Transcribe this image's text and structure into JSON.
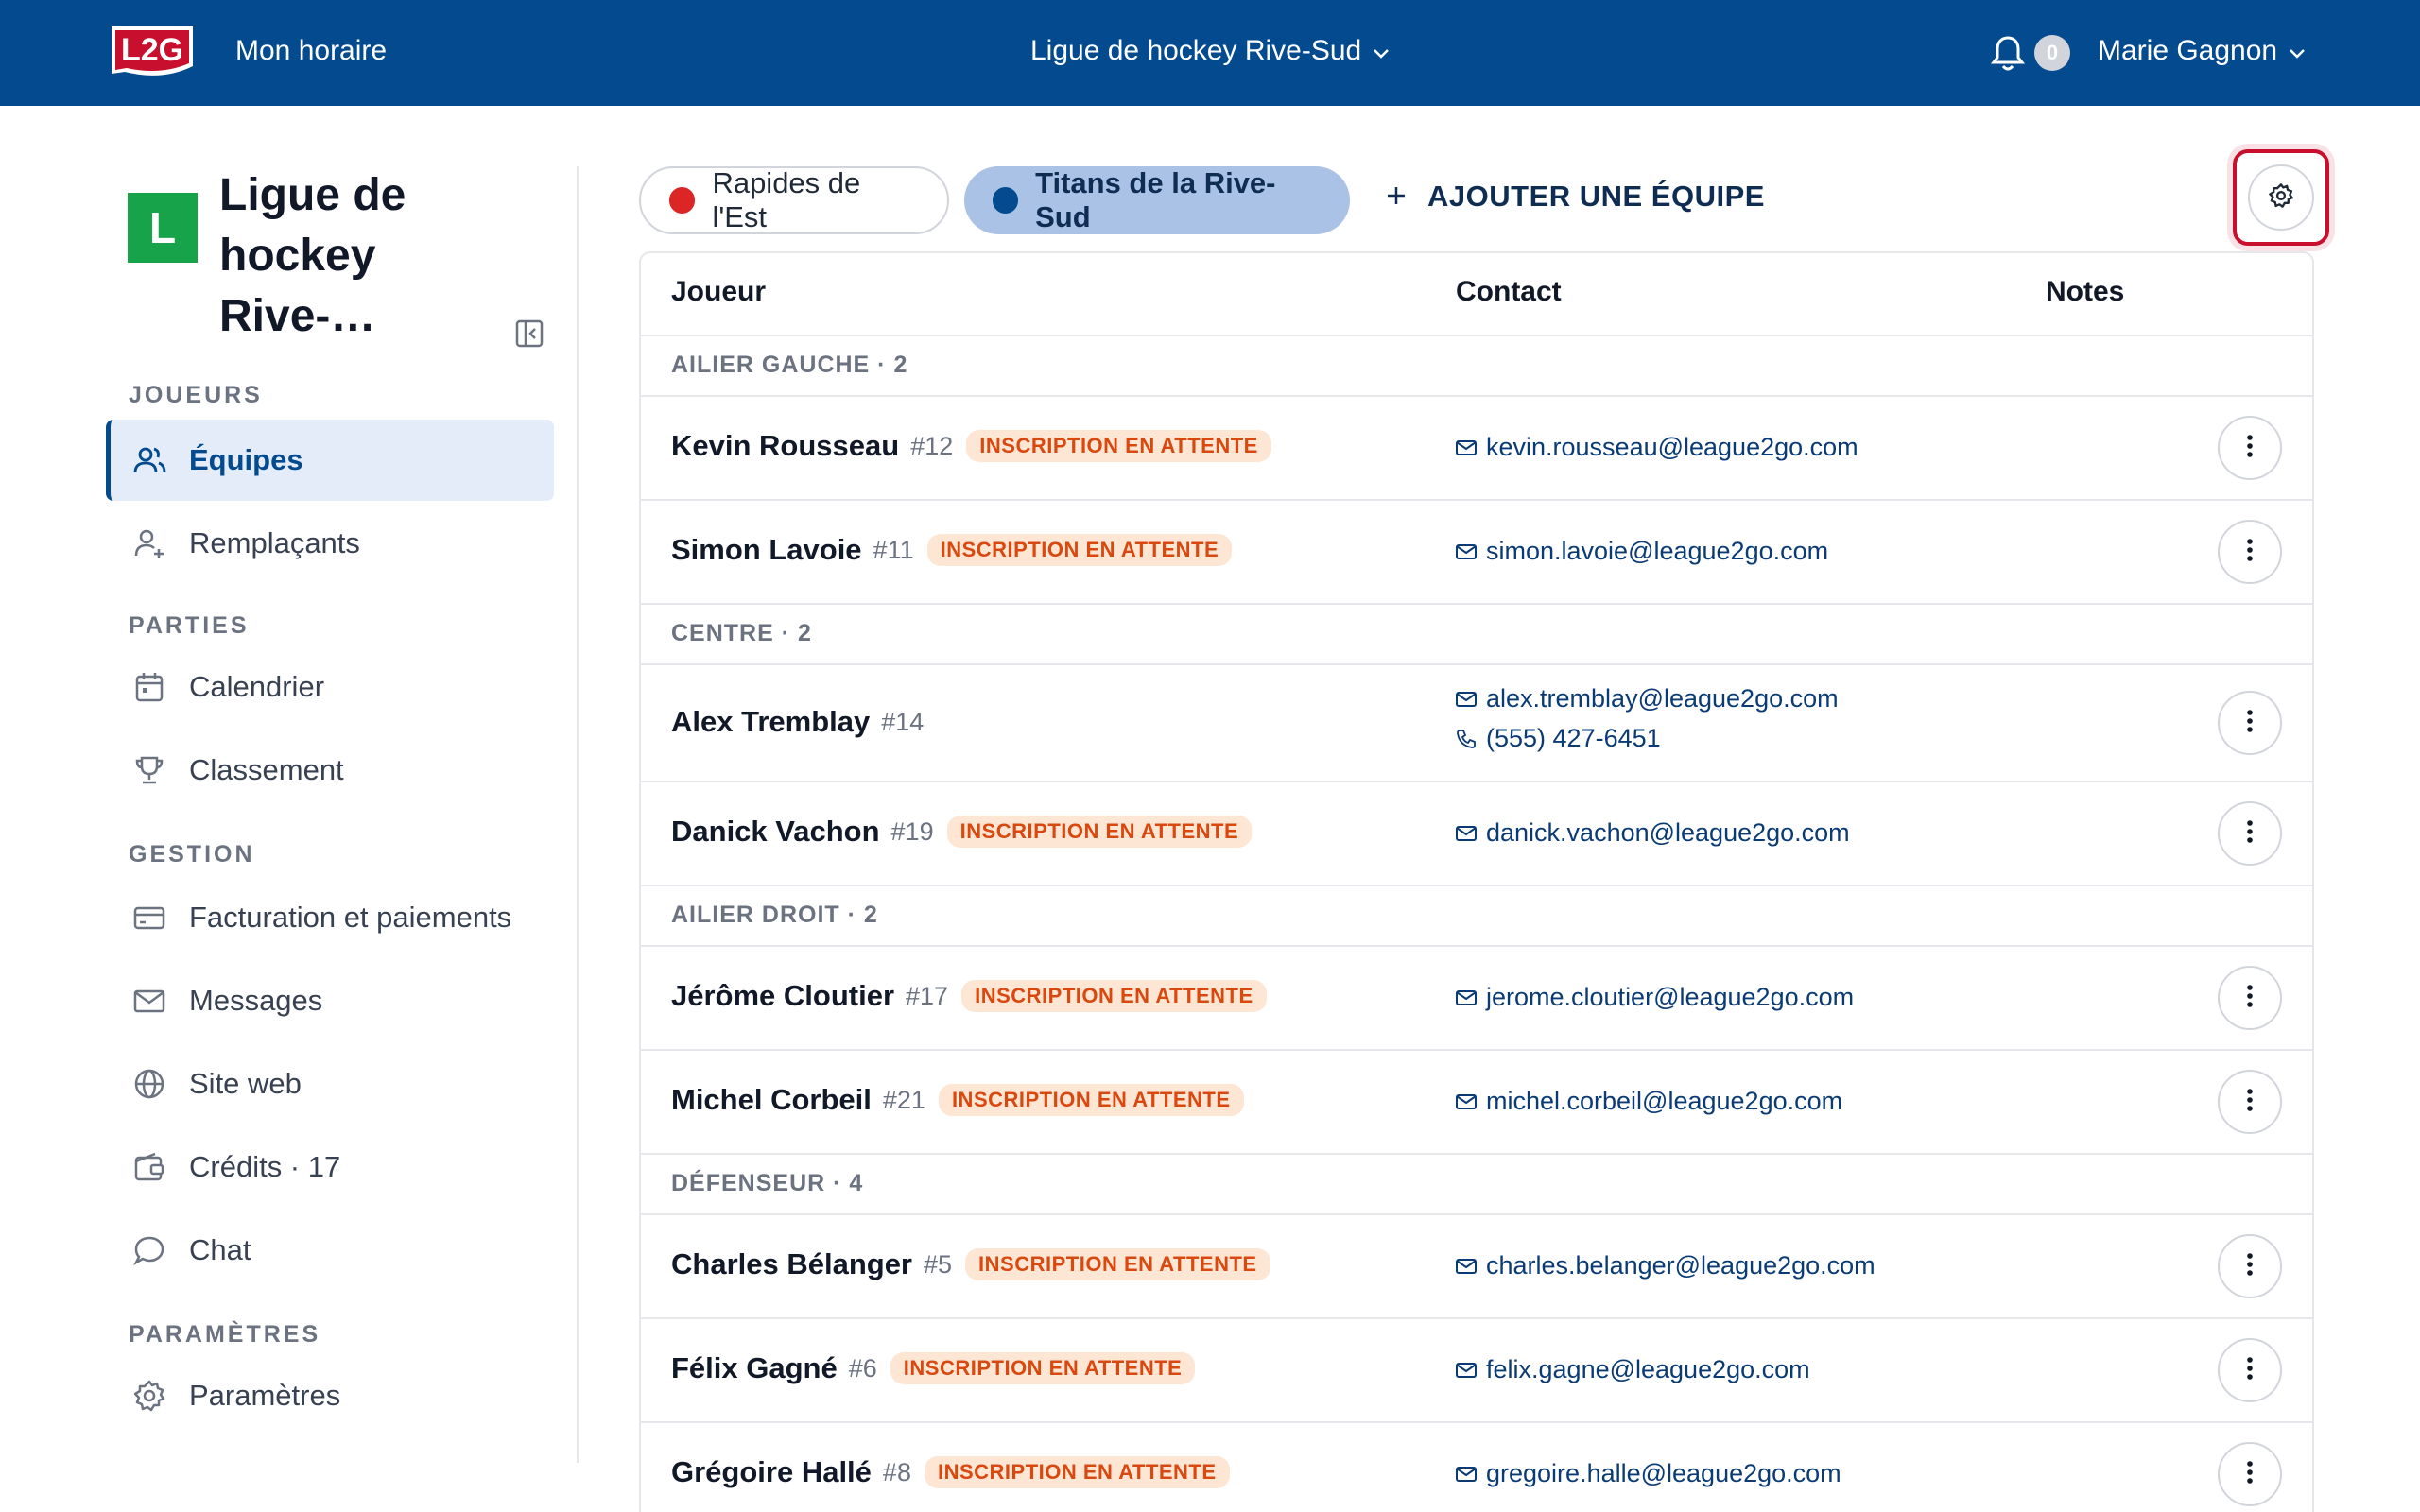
{
  "topbar": {
    "logo_text": "L2G",
    "schedule_link": "Mon horaire",
    "league_selector": "Ligue de hockey Rive-Sud",
    "notification_count": "0",
    "user_name": "Marie Gagnon"
  },
  "sidebar": {
    "league_initial": "L",
    "league_name": "Ligue de hockey Rive-…",
    "sections": {
      "players": "JOUEURS",
      "games": "PARTIES",
      "management": "GESTION",
      "settings": "PARAMÈTRES"
    },
    "items": {
      "teams": "Équipes",
      "substitutes": "Remplaçants",
      "calendar": "Calendrier",
      "standings": "Classement",
      "billing": "Facturation et paiements",
      "messages": "Messages",
      "website": "Site web",
      "credits": "Crédits · 17",
      "chat": "Chat",
      "settings": "Paramètres"
    }
  },
  "teams": {
    "tab1": {
      "name": "Rapides de l'Est",
      "color": "#dc2626"
    },
    "tab2": {
      "name": "Titans de la Rive-Sud",
      "color": "#034a8f"
    },
    "add_label": "AJOUTER UNE ÉQUIPE"
  },
  "table": {
    "headers": {
      "player": "Joueur",
      "contact": "Contact",
      "notes": "Notes"
    },
    "groups": {
      "lw": "AILIER GAUCHE · 2",
      "c": "CENTRE · 2",
      "rw": "AILIER DROIT · 2",
      "d": "DÉFENSEUR · 4"
    },
    "status_pending": "INSCRIPTION EN ATTENTE",
    "players": [
      {
        "name": "Kevin Rousseau",
        "number": "#12",
        "email": "kevin.rousseau@league2go.com"
      },
      {
        "name": "Simon Lavoie",
        "number": "#11",
        "email": "simon.lavoie@league2go.com"
      },
      {
        "name": "Alex Tremblay",
        "number": "#14",
        "email": "alex.tremblay@league2go.com",
        "phone": "(555) 427-6451"
      },
      {
        "name": "Danick Vachon",
        "number": "#19",
        "email": "danick.vachon@league2go.com"
      },
      {
        "name": "Jérôme Cloutier",
        "number": "#17",
        "email": "jerome.cloutier@league2go.com"
      },
      {
        "name": "Michel Corbeil",
        "number": "#21",
        "email": "michel.corbeil@league2go.com"
      },
      {
        "name": "Charles Bélanger",
        "number": "#5",
        "email": "charles.belanger@league2go.com"
      },
      {
        "name": "Félix Gagné",
        "number": "#6",
        "email": "felix.gagne@league2go.com"
      },
      {
        "name": "Grégoire Hallé",
        "number": "#8",
        "email": "gregoire.halle@league2go.com"
      }
    ]
  }
}
